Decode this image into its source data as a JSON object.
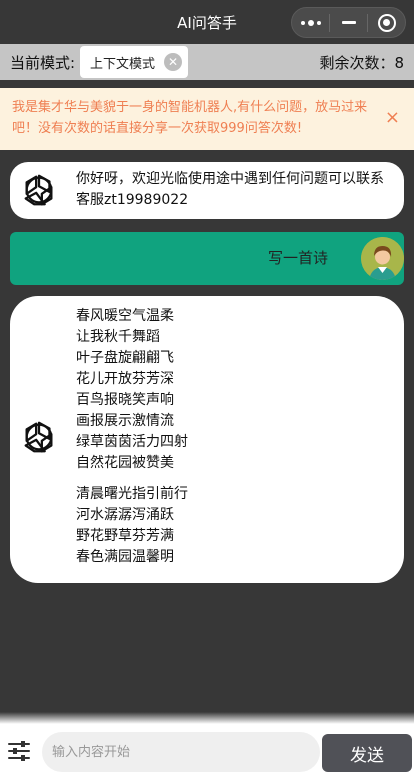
{
  "header": {
    "title": "AI问答手",
    "capsule_icons": [
      "more-dots-icon",
      "minimize-icon",
      "target-icon"
    ]
  },
  "mode_bar": {
    "label": "当前模式:",
    "chip_label": "上下文模式",
    "remaining": "剩余次数：8"
  },
  "notice": {
    "text": "我是集才华与美貌于一身的智能机器人,有什么问题，放马过来吧！没有次数的话直接分享一次获取999问答次数!",
    "close_icon": "×"
  },
  "messages": {
    "ai_greeting": "你好呀，欢迎光临使用途中遇到任何问题可以联系客服zt19989022",
    "user_prompt": "写一首诗",
    "poem_stanza1": [
      "春风暖空气温柔",
      "让我秋千舞蹈",
      "叶子盘旋翩翩飞",
      "花儿开放芬芳深",
      "百鸟报晓笑声响",
      "画报展示激情流",
      "绿草茵茵活力四射",
      "自然花园被赞美"
    ],
    "poem_stanza2": [
      "清晨曙光指引前行",
      "河水潺潺泻涌跃",
      "野花野草芬芳满",
      "春色满园温馨明"
    ]
  },
  "input_bar": {
    "placeholder": "输入内容开始",
    "send_label": "发送"
  },
  "colors": {
    "background": "#373737",
    "user_bubble": "#10a37f",
    "notice_bg": "#fdf2de",
    "notice_text": "#ef7f52",
    "send_button": "#505157"
  }
}
